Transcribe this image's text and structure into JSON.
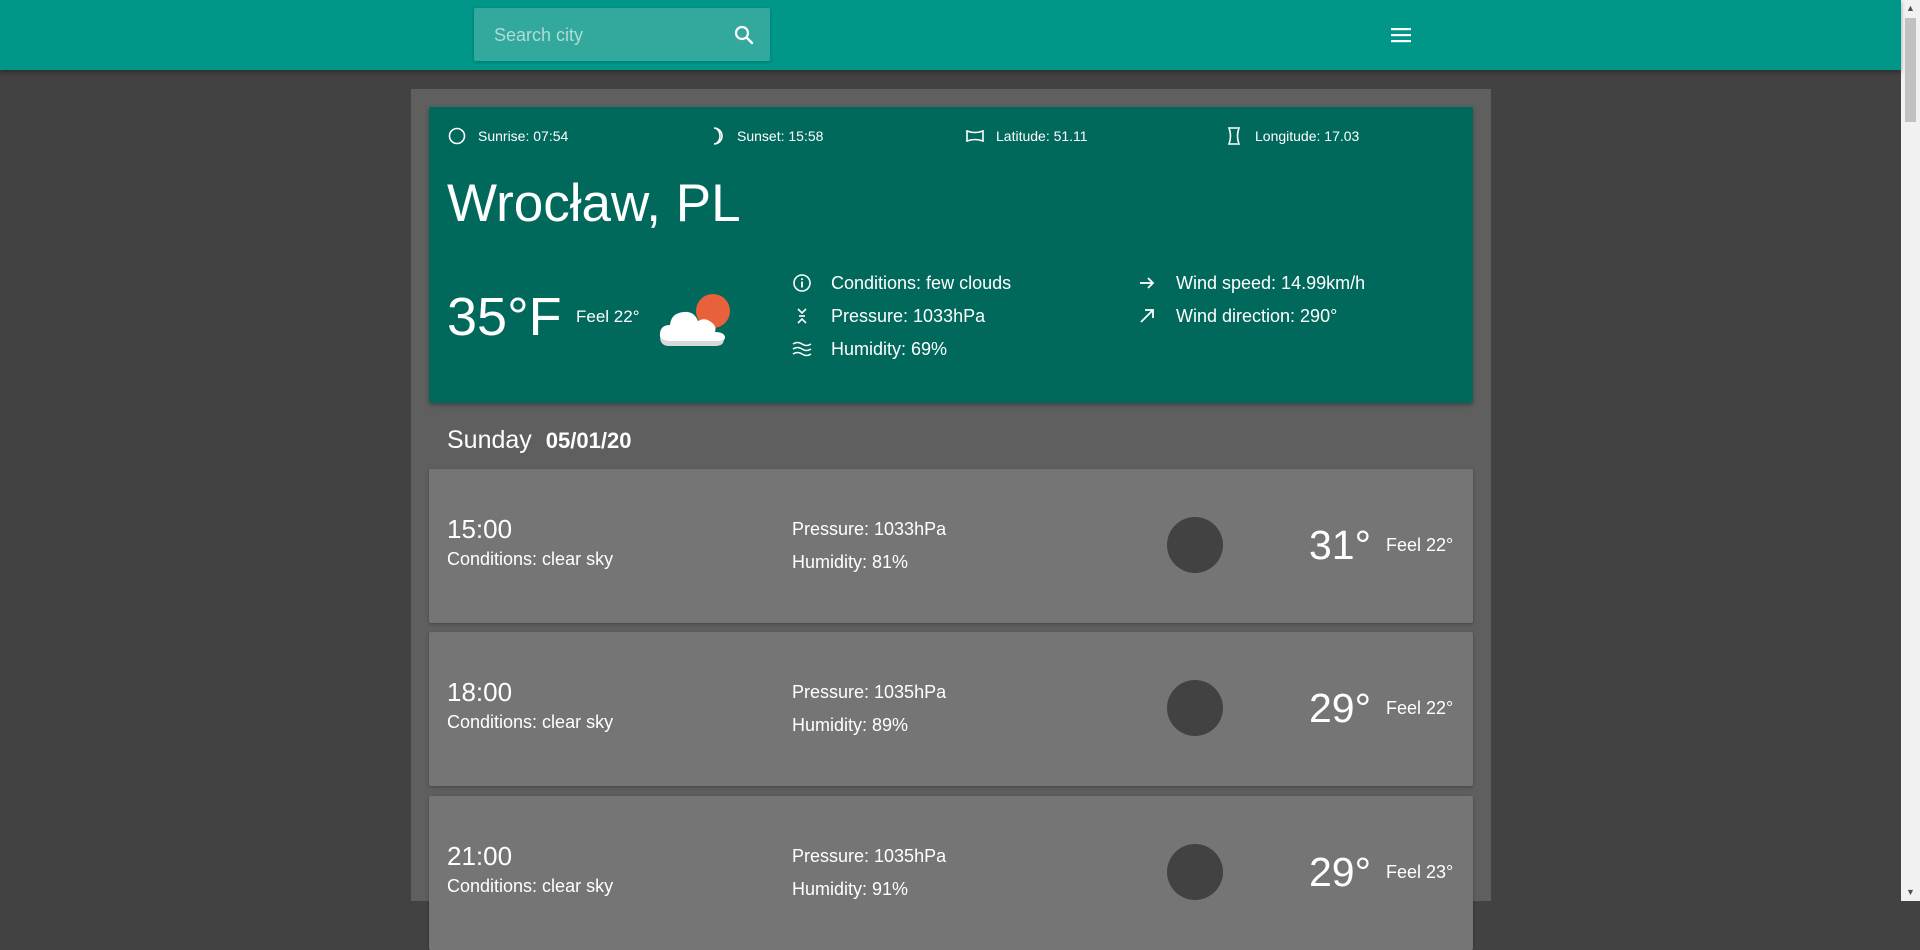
{
  "header": {
    "search_placeholder": "Search city",
    "search_icon": "search-icon",
    "menu_icon": "menu-icon",
    "background_color": "#009688"
  },
  "current": {
    "sunrise": "Sunrise: 07:54",
    "sunset": "Sunset: 15:58",
    "latitude": "Latitude: 51.11",
    "longitude": "Longitude: 17.03",
    "city": "Wrocław, PL",
    "temperature": "35°F",
    "feel": "Feel 22°",
    "weather_icon": "few-clouds-icon",
    "conditions": "Conditions: few clouds",
    "pressure": "Pressure: 1033hPa",
    "humidity": "Humidity: 69%",
    "wind_speed": "Wind speed: 14.99km/h",
    "wind_direction": "Wind direction: 290°",
    "card_color": "#00695c"
  },
  "day": {
    "name": "Sunday",
    "date": "05/01/20"
  },
  "forecast": [
    {
      "time": "15:00",
      "conditions": "Conditions: clear sky",
      "pressure": "Pressure: 1033hPa",
      "humidity": "Humidity: 81%",
      "temp": "31°",
      "feel": "Feel 22°"
    },
    {
      "time": "18:00",
      "conditions": "Conditions: clear sky",
      "pressure": "Pressure: 1035hPa",
      "humidity": "Humidity: 89%",
      "temp": "29°",
      "feel": "Feel 22°"
    },
    {
      "time": "21:00",
      "conditions": "Conditions: clear sky",
      "pressure": "Pressure: 1035hPa",
      "humidity": "Humidity: 91%",
      "temp": "29°",
      "feel": "Feel 23°"
    }
  ]
}
